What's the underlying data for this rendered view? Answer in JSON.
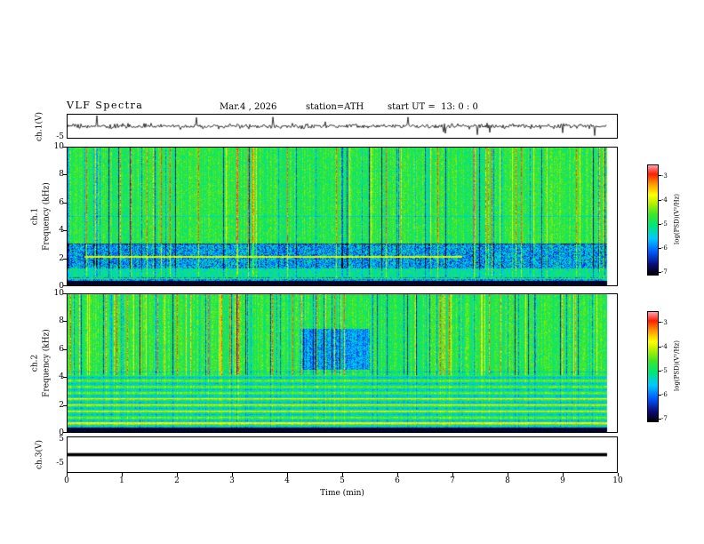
{
  "header": {
    "title": "VLF Spectra",
    "date": "Mar.4 , 2026",
    "station": "station=ATH",
    "start_ut": "start UT =  13: 0 : 0"
  },
  "panels": {
    "ch1_wave": {
      "ylabel": "ch.1(V)",
      "ytick_bottom": "-5"
    },
    "ch1_spec": {
      "ylabel_line1": "ch.1",
      "ylabel_line2": "Frequency (kHz)",
      "yticks": [
        "10",
        "8",
        "6",
        "4",
        "2",
        "0"
      ]
    },
    "ch2_spec": {
      "ylabel_line1": "ch.2",
      "ylabel_line2": "Frequency (kHz)",
      "yticks": [
        "10",
        "8",
        "6",
        "4",
        "2",
        "0"
      ]
    },
    "ch3_wave": {
      "ylabel": "ch.3(V)",
      "ytick_top": "5",
      "ytick_bottom": "-5"
    }
  },
  "xaxis": {
    "label": "Time (min)",
    "ticks": [
      "0",
      "1",
      "2",
      "3",
      "4",
      "5",
      "6",
      "7",
      "8",
      "9",
      "10"
    ]
  },
  "colorbars": [
    {
      "label": "log(PSD)(V²/Hz)",
      "ticks": [
        "-3",
        "-4",
        "-5",
        "-6",
        "-7"
      ]
    },
    {
      "label": "log(PSD)(V²/Hz)",
      "ticks": [
        "-3",
        "-4",
        "-5",
        "-6",
        "-7"
      ]
    }
  ],
  "chart_data": {
    "type": "heatmap",
    "title": "VLF Spectra",
    "subtitle": "Mar.4 , 2026   station=ATH   start UT = 13: 0 : 0",
    "x": {
      "label": "Time (min)",
      "range": [
        0,
        10
      ],
      "ticks": [
        0,
        1,
        2,
        3,
        4,
        5,
        6,
        7,
        8,
        9,
        10
      ],
      "data_end_min": 9.83
    },
    "panels": [
      {
        "channel": "ch.1(V)",
        "type": "line",
        "ylim": [
          -5,
          5
        ],
        "yticks": [
          -5
        ],
        "summary": "continuous broadband noise waveform centered on 0 V, ~1.5 V ripple with frequent impulsive spikes to about +/-4 V"
      },
      {
        "channel": "ch.1",
        "ylabel": "Frequency (kHz)",
        "type": "spectrogram",
        "ylim": [
          0,
          10
        ],
        "yticks": [
          0,
          2,
          4,
          6,
          8,
          10
        ],
        "zlabel": "log(PSD)(V²/Hz)",
        "zlim": [
          -7,
          -3
        ],
        "features": {
          "black_band_khz": [
            0,
            0.3
          ],
          "blue_band_khz": [
            1.2,
            3.0
          ],
          "separator_lines_khz": [
            3.0,
            5.0
          ],
          "yellow_line": {
            "khz": 2.05,
            "t_min": [
              0.3,
              7.3
            ]
          },
          "texture": "green (~-5) background with dense vertical yellow/red sferic streaks (~-3.5) and dark-blue quiet columns; cyan/blue mottling 1-3 kHz"
        }
      },
      {
        "channel": "ch.2",
        "ylabel": "Frequency (kHz)",
        "type": "spectrogram",
        "ylim": [
          0,
          10
        ],
        "yticks": [
          0,
          2,
          4,
          6,
          8,
          10
        ],
        "zlabel": "log(PSD)(V²/Hz)",
        "zlim": [
          -7,
          -3
        ],
        "features": {
          "black_band_khz": [
            0,
            0.28
          ],
          "harmonic_band_khz": [
            0.4,
            4.1
          ],
          "strong_lines_khz": [
            0.62,
            1.5,
            1.95,
            2.4
          ],
          "blue_patch": {
            "t_min": [
              4.3,
              5.6
            ],
            "khz": [
              4.5,
              7.5
            ]
          },
          "texture": "green background with vertical sferic streaks above 4 kHz; bright yellow/orange horizontal harmonic lines below 4 kHz"
        }
      },
      {
        "channel": "ch.3(V)",
        "type": "line",
        "ylim": [
          -5,
          5
        ],
        "yticks": [
          5,
          -5
        ],
        "summary": "flat thick line at constant 0 V (no signal)"
      }
    ],
    "colorbar": {
      "label": "log(PSD)(V²/Hz)",
      "ticks": [
        -3,
        -4,
        -5,
        -6,
        -7
      ],
      "range": [
        -7,
        -3
      ],
      "colormap_low_to_high": [
        "#000000",
        "#0a0a78",
        "#005aff",
        "#00c8ff",
        "#00e678",
        "#3ce628",
        "#b4f000",
        "#ffff00",
        "#ff9600",
        "#ff1e00",
        "#ffa0b4"
      ]
    }
  }
}
